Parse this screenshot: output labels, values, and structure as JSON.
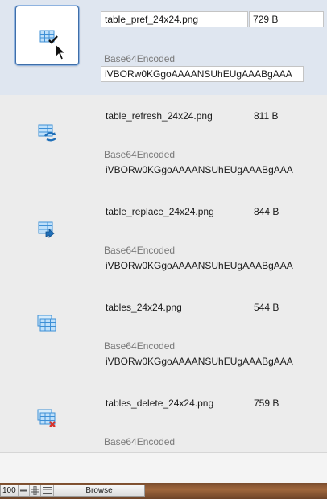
{
  "records": [
    {
      "filename": "table_pref_24x24.png",
      "size": "729 B",
      "encoding_label": "Base64Encoded",
      "encoded": "iVBORw0KGgoAAAANSUhEUgAAABgAAA",
      "icon": "table-check-icon",
      "selected": true
    },
    {
      "filename": "table_refresh_24x24.png",
      "size": "811 B",
      "encoding_label": "Base64Encoded",
      "encoded": "iVBORw0KGgoAAAANSUhEUgAAABgAAA",
      "icon": "table-refresh-icon",
      "selected": false
    },
    {
      "filename": "table_replace_24x24.png",
      "size": "844 B",
      "encoding_label": "Base64Encoded",
      "encoded": "iVBORw0KGgoAAAANSUhEUgAAABgAAA",
      "icon": "table-replace-icon",
      "selected": false
    },
    {
      "filename": "tables_24x24.png",
      "size": "544 B",
      "encoding_label": "Base64Encoded",
      "encoded": "iVBORw0KGgoAAAANSUhEUgAAABgAAA",
      "icon": "tables-icon",
      "selected": false
    },
    {
      "filename": "tables_delete_24x24.png",
      "size": "759 B",
      "encoding_label": "Base64Encoded",
      "encoded": "",
      "icon": "tables-delete-icon",
      "selected": false
    }
  ],
  "statusbar": {
    "zoom": "100",
    "mode": "Browse",
    "zoom_out_icon": "minus-icon",
    "zoom_in_icon": "plus-icon",
    "toggle_icon": "layout-toggle-icon"
  },
  "colors": {
    "icon_blue": "#3d8fd6",
    "icon_light": "#bfe0fa",
    "selection_bg": "#dfe6f0",
    "delete_red": "#d9342b"
  }
}
